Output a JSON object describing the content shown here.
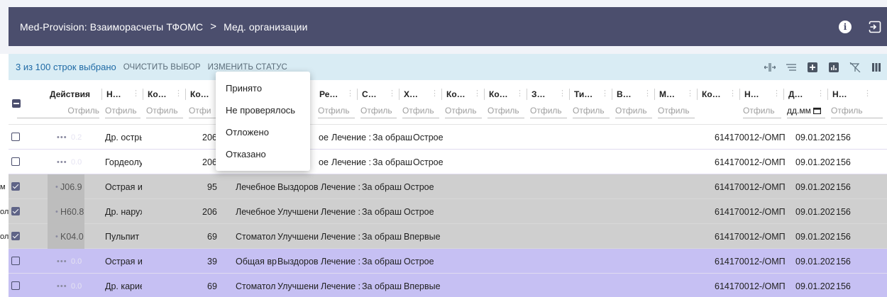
{
  "appbar": {
    "title": "Med-Provision: Взаиморасчеты ТФОМС",
    "separator": ">",
    "section": "Мед. организации",
    "icons": [
      "info-icon",
      "logout-icon"
    ]
  },
  "selection": {
    "count_text": "3 из 100 строк выбрано",
    "clear_label": "Очистить выбор",
    "change_status_label": "Изменить статус",
    "tools": [
      "column-resize-icon",
      "density-icon",
      "add-icon",
      "chart-icon",
      "filter-off-icon",
      "columns-icon"
    ]
  },
  "status_menu": {
    "items": [
      "Принято",
      "Не проверялось",
      "Отложено",
      "Отказано"
    ]
  },
  "columns": [
    {
      "key": "actions",
      "label": "Действия",
      "filter": "Отфиль"
    },
    {
      "key": "c1",
      "label": "Н…",
      "filter": "Отфиль"
    },
    {
      "key": "c2",
      "label": "Ко…",
      "filter": "Отфиль"
    },
    {
      "key": "c3",
      "label": "Ко…",
      "filter": "Отфи"
    },
    {
      "key": "c4",
      "label": "Ре…",
      "filter": "Отфиль"
    },
    {
      "key": "c5",
      "label": "С…",
      "filter": "Отфиль"
    },
    {
      "key": "c6",
      "label": "Х…",
      "filter": "Отфиль"
    },
    {
      "key": "c7",
      "label": "Ко…",
      "filter": "Отфиль"
    },
    {
      "key": "c8",
      "label": "Ко…",
      "filter": "Отфиль"
    },
    {
      "key": "c9",
      "label": "З…",
      "filter": "Отфиль"
    },
    {
      "key": "c10",
      "label": "Ти…",
      "filter": "Отфиль"
    },
    {
      "key": "c11",
      "label": "В…",
      "filter": "Отфиль"
    },
    {
      "key": "c12",
      "label": "М…",
      "filter": "Отфиль"
    },
    {
      "key": "c13",
      "label": "Ко…",
      "filter": ""
    },
    {
      "key": "c14",
      "label": "Н…",
      "filter": "Отфиль"
    },
    {
      "key": "c15",
      "label": "Д…",
      "filter": "дд.мм"
    },
    {
      "key": "c16",
      "label": "Н…",
      "filter": "Отфиль"
    }
  ],
  "rows": [
    {
      "selected": false,
      "action": "•••",
      "ghost": "0.2",
      "diag": "Др. острь",
      "code": "206",
      "profile": "",
      "result": "ое",
      "c5": "Лечение :",
      "c6": "За обраш",
      "c7": "Острое",
      "code2": "6141700",
      "omp": "12-/ОМП",
      "date": "09.01.202",
      "num": "156"
    },
    {
      "selected": false,
      "action": "•••",
      "ghost": "0.0",
      "diag": "Гордеолуі",
      "code": "206",
      "profile": "",
      "result": "ое",
      "c5": "Лечение :",
      "c6": "За обраш",
      "c7": "Острое",
      "code2": "6141700",
      "omp": "12-/ОМП",
      "date": "09.01.202",
      "num": "156"
    },
    {
      "selected": true,
      "lead": "м",
      "action": "•",
      "ghost": "J06.9",
      "diag": "Острая иі",
      "code": "95",
      "profile": "Лечебное",
      "result": "Выздоров",
      "c5": "Лечение :",
      "c6": "За обраш",
      "c7": "Острое",
      "code2": "6141700",
      "omp": "12-/ОМП",
      "date": "09.01.202",
      "num": "156"
    },
    {
      "selected": true,
      "lead": "ол",
      "action": "•",
      "ghost": "H60.8",
      "diag": "Др. наруж",
      "code": "206",
      "profile": "Лечебное",
      "result": "Улучшени",
      "c5": "Лечение :",
      "c6": "За обраш",
      "c7": "Острое",
      "code2": "6141700",
      "omp": "12-/ОМП",
      "date": "09.01.202",
      "num": "156"
    },
    {
      "selected": true,
      "lead": "ол",
      "action": "•",
      "ghost": "K04.0",
      "diag": "Пульпит",
      "code": "69",
      "profile": "Стоматол",
      "result": "Улучшени",
      "c5": "Лечение :",
      "c6": "За обраш",
      "c7": "Впервые",
      "code2": "6141700",
      "omp": "12-/ОМП",
      "date": "09.01.202",
      "num": "156"
    },
    {
      "selected": false,
      "action": "•••",
      "ghost": "0.0",
      "diag": "Острая иі",
      "code": "39",
      "profile": "Общая вр",
      "result": "Выздоров",
      "c5": "Лечение :",
      "c6": "За обраш",
      "c7": "Острое",
      "code2": "6141700",
      "omp": "12-/ОМП",
      "date": "09.01.202",
      "num": "156"
    },
    {
      "selected": false,
      "action": "•••",
      "ghost": "0.0",
      "diag": "Др. карие",
      "code": "69",
      "profile": "Стоматол",
      "result": "Улучшени",
      "c5": "Лечение :",
      "c6": "За обраш",
      "c7": "Впервые",
      "code2": "6141700",
      "omp": "12-/ОМП",
      "date": "09.01.202",
      "num": "156"
    }
  ],
  "colors": {
    "appbar": "#4b4e6d",
    "selection_bar": "#d9ecf4",
    "row_selected": "#c6c0f3",
    "row_unselected": "#cfcfcf"
  }
}
